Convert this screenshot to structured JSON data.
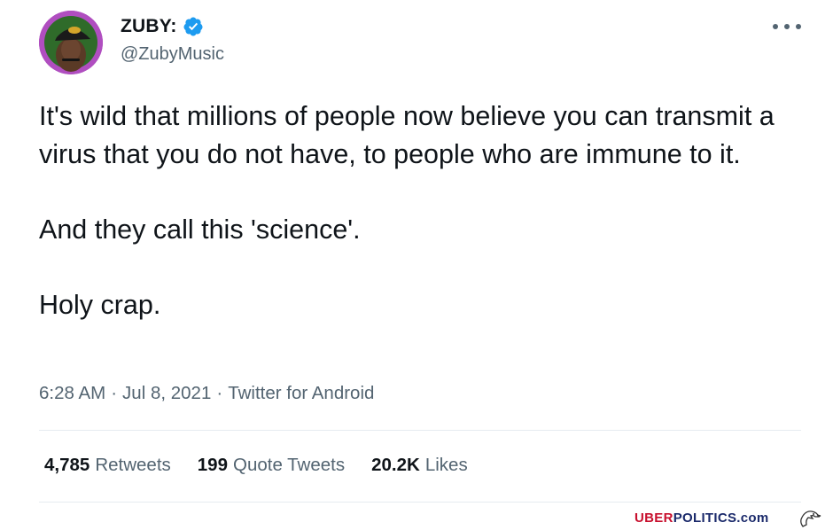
{
  "author": {
    "display_name": "ZUBY:",
    "handle": "@ZubyMusic",
    "verified": true,
    "avatar_ring_color": "#b04ec0"
  },
  "tweet": {
    "paragraphs": [
      "It's wild that millions of people now believe you can transmit a virus that you do not have, to people who are immune to it.",
      "And they call this 'science'.",
      "Holy crap."
    ],
    "time": "6:28 AM",
    "date": "Jul 8, 2021",
    "source": "Twitter for Android",
    "separator": "·"
  },
  "stats": {
    "retweets_count": "4,785",
    "retweets_label": "Retweets",
    "quote_count": "199",
    "quote_label": "Quote Tweets",
    "likes_count": "20.2K",
    "likes_label": "Likes"
  },
  "watermark": {
    "part1": "UBER",
    "part2": "POLITICS.com"
  },
  "icons": {
    "verified": "verified-badge-icon",
    "more": "more-options-icon",
    "watermark_logo": "eagle-icon"
  },
  "colors": {
    "verified_blue": "#1d9bf0",
    "text": "#0f1419",
    "secondary": "#536471",
    "watermark_red": "#c8102e",
    "watermark_navy": "#1b2a6b"
  }
}
